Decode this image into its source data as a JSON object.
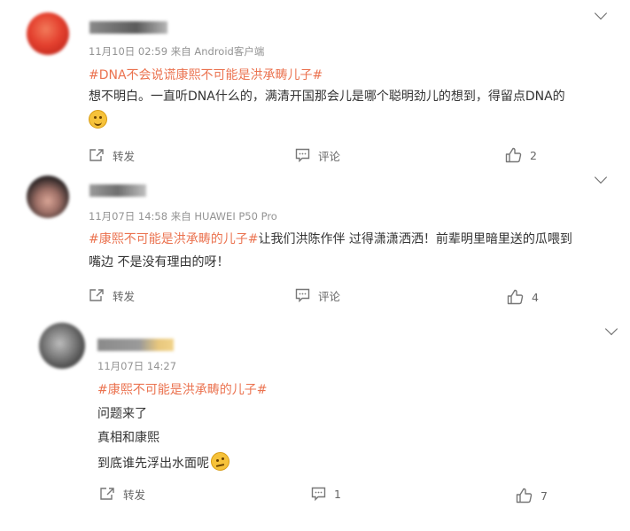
{
  "comments": [
    {
      "meta": "11月10日 02:59  来自 Android客户端",
      "tag": "#DNA不会说谎康熙不可能是洪承畴儿子#",
      "lines": [
        "想不明白。一直听DNA什么的，满清开国那会儿是哪个聪明劲儿的想到，得留点DNA的"
      ],
      "emoji": "thinking-emoji",
      "actions": {
        "repost": "转发",
        "comment": "评论",
        "likes": "2"
      }
    },
    {
      "meta": "11月07日 14:58  来自 HUAWEI P50 Pro",
      "tag": "#康熙不可能是洪承畴的儿子#",
      "tag_rest": "让我们洪陈作伴 过得潇潇洒洒！前辈明里暗里送的瓜喂到",
      "lines": [
        "嘴边 不是没有理由的呀！"
      ],
      "actions": {
        "repost": "转发",
        "comment": "评论",
        "likes": "4"
      }
    },
    {
      "meta": "11月07日 14:27",
      "tag": "#康熙不可能是洪承畴的儿子#",
      "lines": [
        "问题来了",
        "真相和康熙",
        "到底谁先浮出水面呢"
      ],
      "emoji": "confused-emoji",
      "actions": {
        "repost": "转发",
        "comment": "1",
        "likes": "7"
      }
    }
  ],
  "colors": {
    "accent": "#eb7350",
    "meta": "#939393",
    "text": "#333333"
  }
}
